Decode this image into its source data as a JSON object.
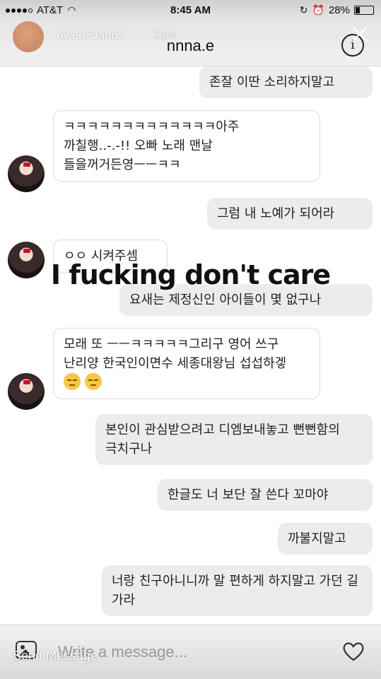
{
  "status": {
    "carrier": "AT&T",
    "time": "8:45 AM",
    "battery": "28%",
    "battery_level": 0.28
  },
  "story": {
    "owner": "owen5vadoz",
    "age": "32m"
  },
  "chat": {
    "title": "nnna.e",
    "messages": [
      {
        "side": "out",
        "text": "존잘 이딴 소리하지말고"
      },
      {
        "side": "in",
        "text": "ㅋㅋㅋㅋㅋㅋㅋㅋㅋㅋㅋㅋㅋ아주 까칠행..-.-!! 오빠 노래 맨날 들을꺼거든영ㅡㅡㅋㅋ"
      },
      {
        "side": "out",
        "text": "그럼 내 노예가 되어라"
      },
      {
        "side": "in",
        "text": "ㅇㅇ 시켜주셈"
      },
      {
        "side": "out",
        "text": "요새는 제정신인 아이들이 몇 없구나"
      },
      {
        "side": "in",
        "text": "모래 또 ㅡㅡㅋㅋㅋㅋㅋ그리구 영어 쓰구 난리양 한국인이면수 세종대왕님 섭섭하겧"
      },
      {
        "side": "out",
        "text": "본인이 관심받으려고 디엠보내놓고 뻔뻔함의 극치구나"
      },
      {
        "side": "out",
        "text": "한글도 너 보단 잘 쓴다 꼬마야"
      },
      {
        "side": "out",
        "text": "까불지말고"
      },
      {
        "side": "out",
        "text": "너랑 친구아니니까 말 편하게 하지말고 가던 길 가라"
      }
    ]
  },
  "overlay": {
    "caption": "I fucking don't care"
  },
  "composer": {
    "placeholder": "Write a message...",
    "send_label": "Send Message"
  },
  "icons": {
    "close": "close-icon",
    "info": "info-icon",
    "gallery": "gallery-icon",
    "heart": "heart-icon"
  }
}
